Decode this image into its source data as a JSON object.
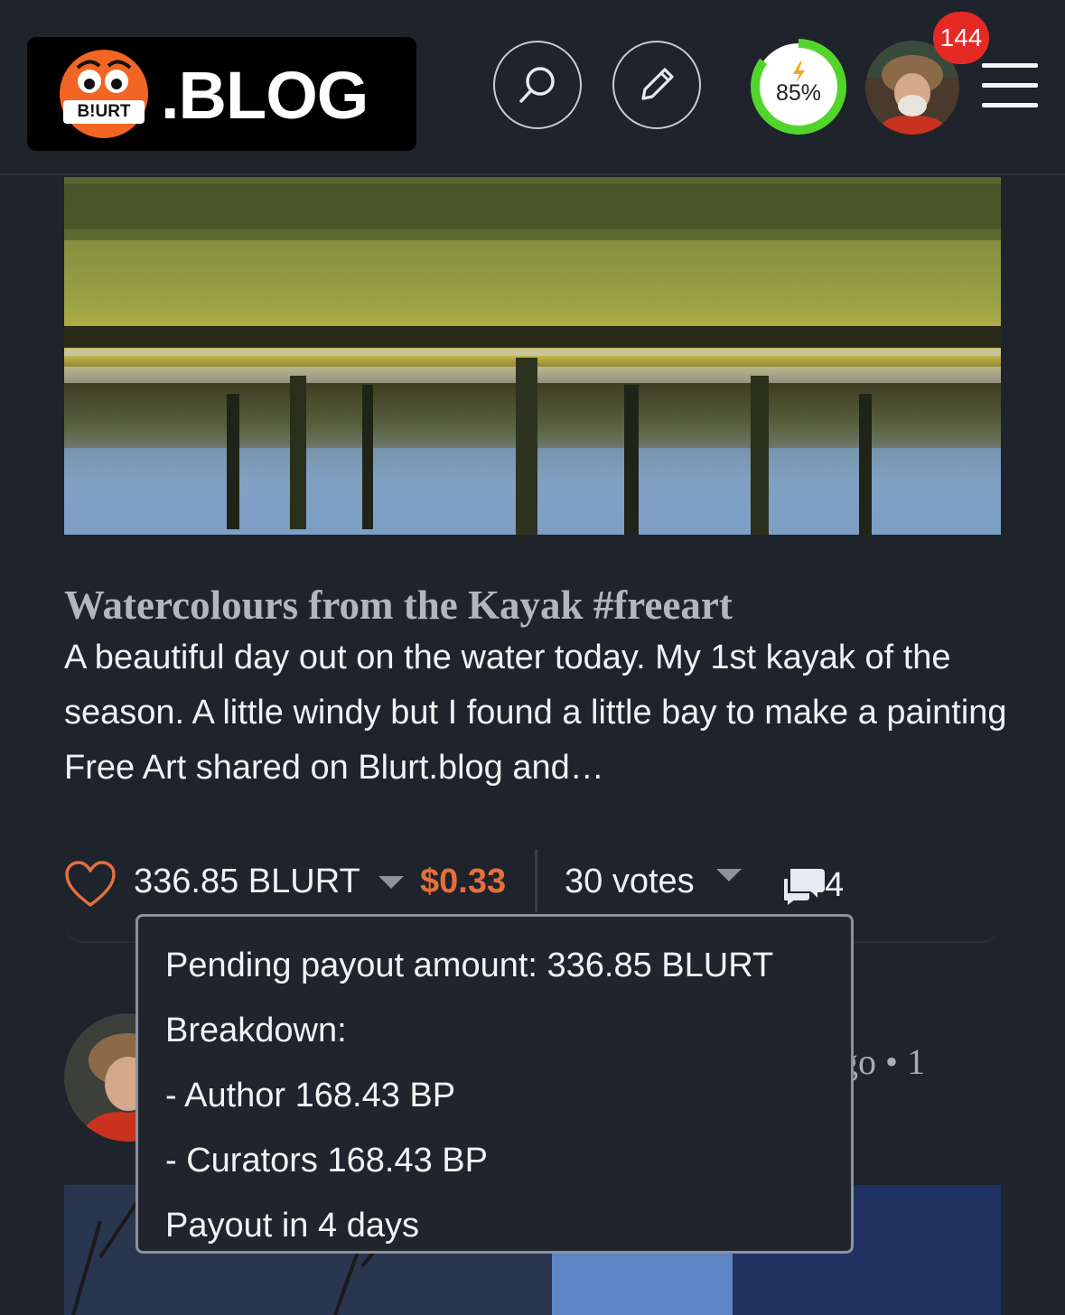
{
  "header": {
    "logo_badge_text": "B!URT",
    "logo_text": ".BLOG",
    "voting_power": "85%",
    "notification_count": "144",
    "icons": {
      "search": "search-icon",
      "edit": "pencil-icon",
      "power": "lightning-icon",
      "menu": "hamburger-icon"
    },
    "colors": {
      "power_ring": "#52d52b",
      "badge": "#e52a25",
      "logo_mascot": "#f26522"
    }
  },
  "post": {
    "title": "Watercolours from the Kayak #freeart",
    "excerpt": "A beautiful day out on the water today. My 1st kayak of the season. A little windy but I found a little bay to make a painting Free Art shared on Blurt.blog and…",
    "payout_amount": "336.85 BLURT",
    "payout_usd": "$0.33",
    "votes": "30 votes",
    "comments": "4",
    "colors": {
      "usd": "#e4703b",
      "heart": "#e4703b"
    }
  },
  "tooltip": {
    "pending": "Pending payout amount: 336.85 BLURT",
    "breakdown": "Breakdown:",
    "author": "- Author 168.43 BP",
    "curators": "- Curators 168.43 BP",
    "payout_in": "Payout in 4 days"
  },
  "next_post": {
    "meta_partial": "go • 1"
  }
}
